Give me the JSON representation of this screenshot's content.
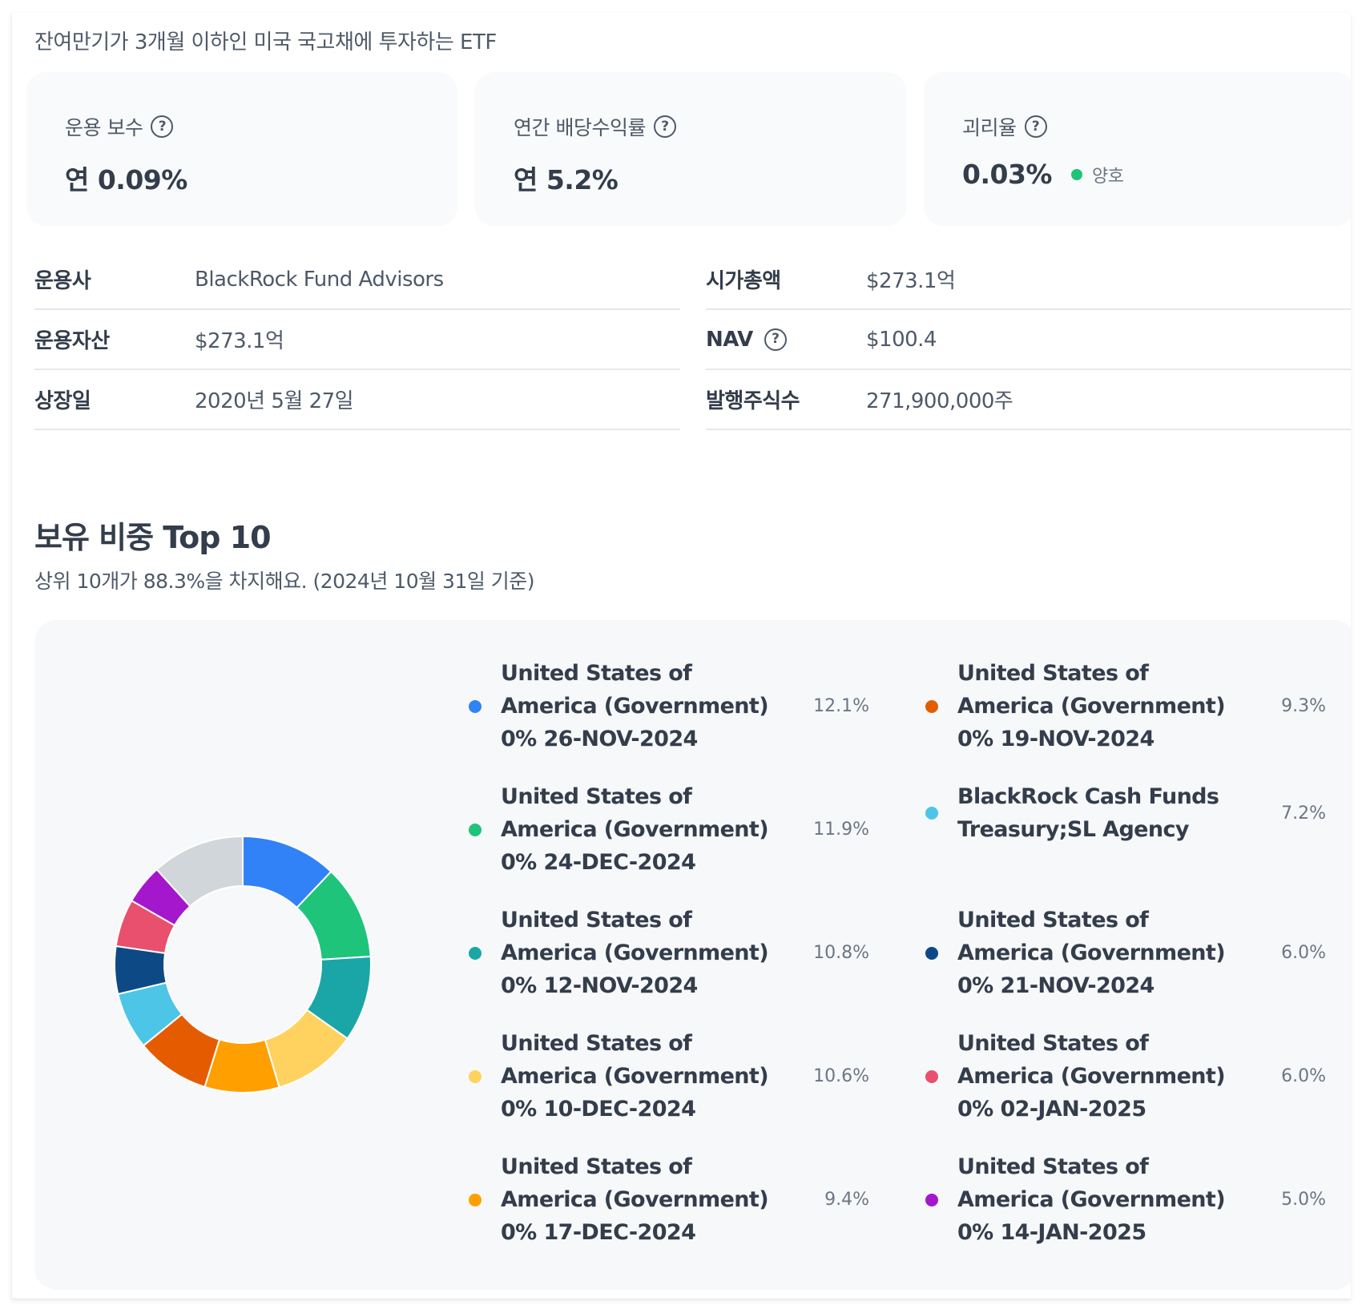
{
  "description": "잔여만기가 3개월 이하인 미국 국고채에 투자하는 ETF",
  "cards": [
    {
      "label": "운용 보수",
      "value": "연 0.09%"
    },
    {
      "label": "연간 배당수익률",
      "value": "연 5.2%"
    },
    {
      "label": "괴리율",
      "value": "0.03%",
      "status": "양호",
      "status_color": "#1ec47a"
    }
  ],
  "info": {
    "left": [
      {
        "label": "운용사",
        "value": "BlackRock Fund Advisors"
      },
      {
        "label": "운용자산",
        "value": "$273.1억"
      },
      {
        "label": "상장일",
        "value": "2020년 5월 27일"
      }
    ],
    "right": [
      {
        "label": "시가총액",
        "value": "$273.1억"
      },
      {
        "label": "NAV",
        "value": "$100.4"
      },
      {
        "label": "발행주식수",
        "value": "271,900,000주"
      }
    ]
  },
  "holdings": {
    "title": "보유 비중 Top 10",
    "subtitle": "상위 10개가 88.3%을 차지해요. (2024년 10월 31일 기준)"
  },
  "chart_data": {
    "type": "pie",
    "donut": true,
    "categories": [
      "United States of America (Government) 0% 26-NOV-2024",
      "United States of America (Government) 0% 24-DEC-2024",
      "United States of America (Government) 0% 12-NOV-2024",
      "United States of America (Government) 0% 10-DEC-2024",
      "United States of America (Government) 0% 17-DEC-2024",
      "United States of America (Government) 0% 19-NOV-2024",
      "BlackRock Cash Funds Treasury;SL Agency",
      "United States of America (Government) 0% 21-NOV-2024",
      "United States of America (Government) 0% 02-JAN-2025",
      "United States of America (Government) 0% 14-JAN-2025"
    ],
    "values": [
      12.1,
      11.9,
      10.8,
      10.6,
      9.4,
      9.3,
      7.2,
      6.0,
      6.0,
      5.0
    ],
    "labels": [
      "12.1%",
      "11.9%",
      "10.8%",
      "10.6%",
      "9.4%",
      "9.3%",
      "7.2%",
      "6.0%",
      "6.0%",
      "5.0%"
    ],
    "colors": [
      "#3182f6",
      "#1ec47a",
      "#1aa6a6",
      "#ffd25f",
      "#ff9f00",
      "#e55c00",
      "#4dc5e6",
      "#0d4a85",
      "#e8506e",
      "#a517cc"
    ],
    "other_color": "#d1d6db"
  }
}
